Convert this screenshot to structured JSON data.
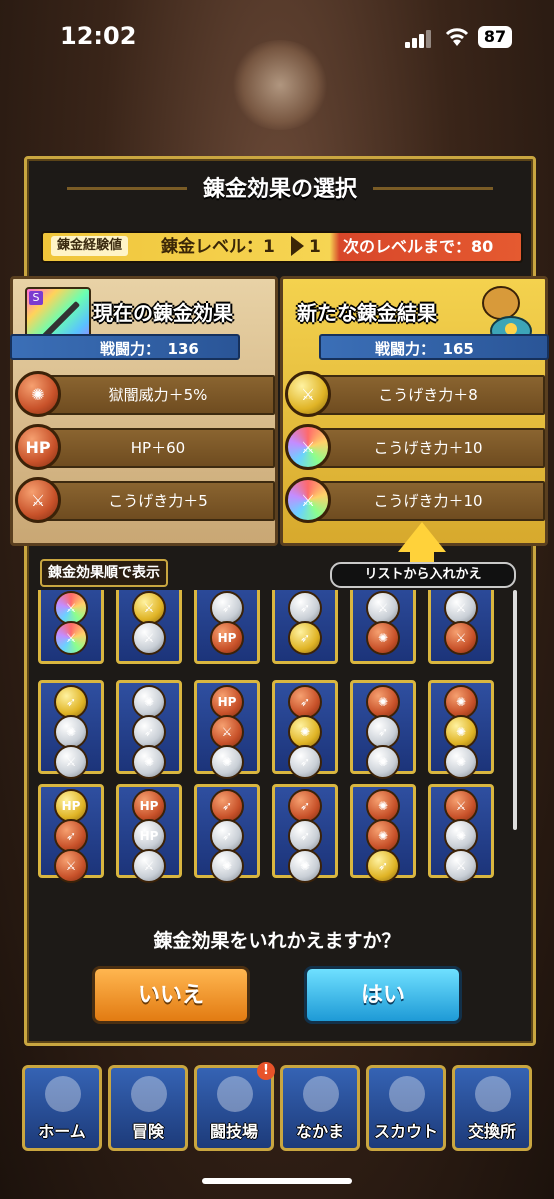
{
  "status": {
    "time": "12:02",
    "battery": "87"
  },
  "dialog": {
    "title": "錬金効果の選択",
    "exp": {
      "tag": "錬金経験値",
      "level_text": "錬金レベル：1",
      "level_new": "1",
      "next_text": "次のレベルまで：80"
    },
    "current": {
      "title": "現在の錬金効果",
      "rank_badge": "S",
      "power": "戦闘力：　136",
      "effects": [
        {
          "icon": "vortex",
          "medal": "bronze",
          "label": "獄闇威力＋5%"
        },
        {
          "icon": "HP",
          "medal": "bronze",
          "label": "HP＋60"
        },
        {
          "icon": "sword",
          "medal": "bronze",
          "label": "こうげき力＋5"
        }
      ]
    },
    "new": {
      "title": "新たな錬金結果",
      "power": "戦闘力：　165",
      "effects": [
        {
          "icon": "sword",
          "medal": "gold",
          "label": "こうげき力＋8"
        },
        {
          "icon": "sword",
          "medal": "rainbow",
          "label": "こうげき力＋10"
        },
        {
          "icon": "sword",
          "medal": "rainbow",
          "label": "こうげき力＋10"
        }
      ]
    },
    "sort_label": "錬金効果順で表示",
    "list_label": "リストから入れかえ",
    "question": "錬金効果をいれかえますか？",
    "no_label": "いいえ",
    "yes_label": "はい"
  },
  "grid": [
    [
      [
        "rainbow",
        "sword"
      ],
      [
        "rainbow",
        "sword"
      ]
    ],
    [
      [
        "gold",
        "sword"
      ],
      [
        "silver",
        "sword"
      ]
    ],
    [
      [
        "silver",
        "wing"
      ],
      [
        "bronze",
        "HP"
      ]
    ],
    [
      [
        "silver",
        "wing"
      ],
      [
        "gold",
        "wing"
      ]
    ],
    [
      [
        "silver",
        "sword"
      ],
      [
        "bronze",
        "vortex"
      ]
    ],
    [
      [
        "silver",
        "sword"
      ],
      [
        "bronze",
        "sword"
      ]
    ],
    [
      [
        "gold",
        "wing"
      ],
      [
        "silver",
        "vortex"
      ],
      [
        "silver",
        "sword"
      ]
    ],
    [
      [
        "silver",
        "vortex"
      ],
      [
        "silver",
        "wing"
      ],
      [
        "silver",
        "vortex"
      ]
    ],
    [
      [
        "bronze",
        "HP"
      ],
      [
        "bronze",
        "sword"
      ],
      [
        "silver",
        "vortex"
      ]
    ],
    [
      [
        "bronze",
        "wing"
      ],
      [
        "gold",
        "vortex"
      ],
      [
        "silver",
        "wing"
      ]
    ],
    [
      [
        "bronze",
        "vortex"
      ],
      [
        "silver",
        "wing"
      ],
      [
        "silver",
        "vortex"
      ]
    ],
    [
      [
        "bronze",
        "vortex"
      ],
      [
        "gold",
        "vortex"
      ],
      [
        "silver",
        "vortex"
      ]
    ],
    [
      [
        "gold",
        "HP"
      ],
      [
        "bronze",
        "wing"
      ],
      [
        "bronze",
        "sword"
      ]
    ],
    [
      [
        "bronze",
        "HP"
      ],
      [
        "silver",
        "HP"
      ],
      [
        "silver",
        "sword"
      ]
    ],
    [
      [
        "bronze",
        "wing"
      ],
      [
        "silver",
        "wing"
      ],
      [
        "silver",
        "vortex"
      ]
    ],
    [
      [
        "bronze",
        "wing"
      ],
      [
        "silver",
        "wing"
      ],
      [
        "silver",
        "vortex"
      ]
    ],
    [
      [
        "bronze",
        "vortex"
      ],
      [
        "bronze",
        "vortex"
      ],
      [
        "gold",
        "wing"
      ]
    ],
    [
      [
        "bronze",
        "sword"
      ],
      [
        "silver",
        "vortex"
      ],
      [
        "silver",
        "sword"
      ]
    ]
  ],
  "nav": [
    {
      "label": "ホーム",
      "badge": ""
    },
    {
      "label": "冒険",
      "badge": ""
    },
    {
      "label": "闘技場",
      "badge": "!"
    },
    {
      "label": "なかま",
      "badge": ""
    },
    {
      "label": "スカウト",
      "badge": ""
    },
    {
      "label": "交換所",
      "badge": ""
    }
  ]
}
